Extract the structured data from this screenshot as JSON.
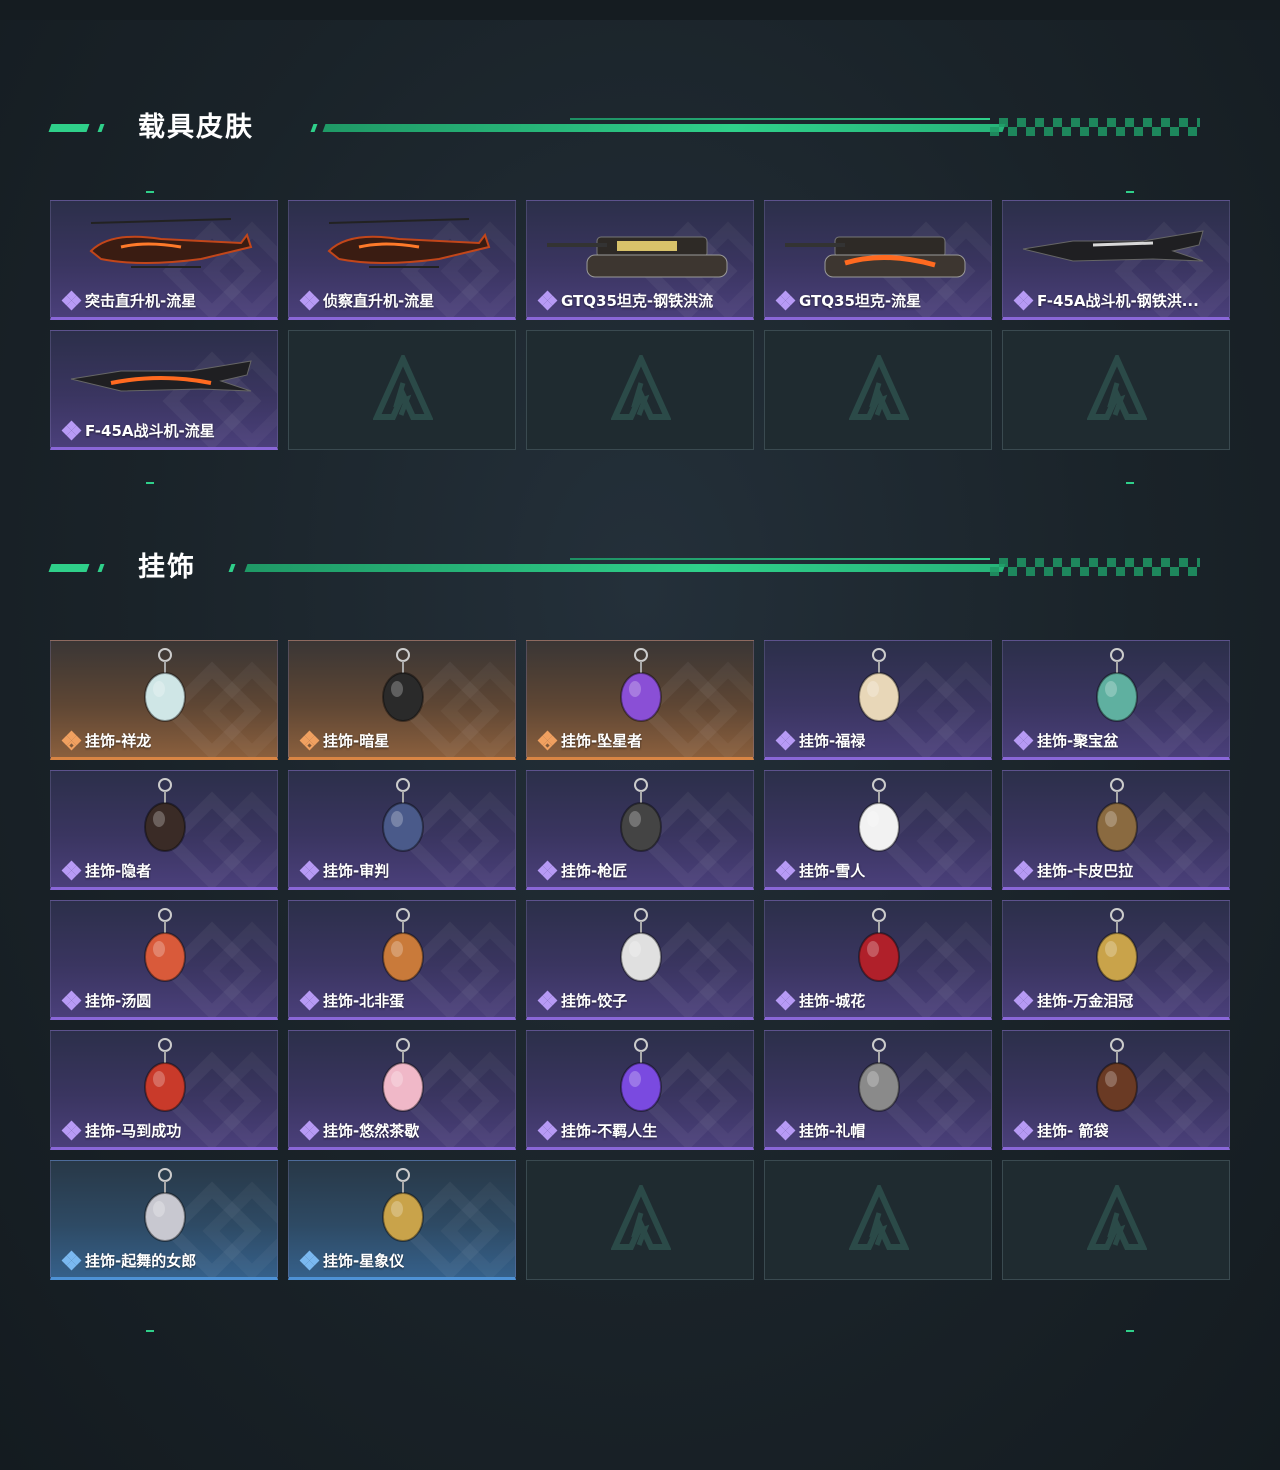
{
  "sections": [
    {
      "title": "载具皮肤",
      "items": [
        {
          "name": "突击直升机-流星",
          "rarity": "epic",
          "icon": "helicopter-attack-icon"
        },
        {
          "name": "侦察直升机-流星",
          "rarity": "epic",
          "icon": "helicopter-scout-icon"
        },
        {
          "name": "GTQ35坦克-钢铁洪流",
          "rarity": "epic",
          "icon": "tank-steel-icon"
        },
        {
          "name": "GTQ35坦克-流星",
          "rarity": "epic",
          "icon": "tank-meteor-icon"
        },
        {
          "name": "F-45A战斗机-钢铁洪...",
          "rarity": "epic",
          "icon": "jet-steel-icon"
        },
        {
          "name": "F-45A战斗机-流星",
          "rarity": "epic",
          "icon": "jet-meteor-icon"
        },
        {
          "name": "",
          "rarity": "empty"
        },
        {
          "name": "",
          "rarity": "empty"
        },
        {
          "name": "",
          "rarity": "empty"
        },
        {
          "name": "",
          "rarity": "empty"
        }
      ]
    },
    {
      "title": "挂饰",
      "items": [
        {
          "name": "挂饰-祥龙",
          "rarity": "legend",
          "icon": "dragon-charm-icon"
        },
        {
          "name": "挂饰-暗星",
          "rarity": "legend",
          "icon": "dark-star-charm-icon"
        },
        {
          "name": "挂饰-坠星者",
          "rarity": "legend",
          "icon": "crystal-charm-icon"
        },
        {
          "name": "挂饰-福禄",
          "rarity": "epic",
          "icon": "gourd-charm-icon"
        },
        {
          "name": "挂饰-聚宝盆",
          "rarity": "epic",
          "icon": "treasure-bowl-charm-icon"
        },
        {
          "name": "挂饰-隐者",
          "rarity": "epic",
          "icon": "hermit-card-charm-icon"
        },
        {
          "name": "挂饰-审判",
          "rarity": "epic",
          "icon": "judgement-card-charm-icon"
        },
        {
          "name": "挂饰-枪匠",
          "rarity": "epic",
          "icon": "gunsmith-charm-icon"
        },
        {
          "name": "挂饰-雪人",
          "rarity": "epic",
          "icon": "snowman-charm-icon"
        },
        {
          "name": "挂饰-卡皮巴拉",
          "rarity": "epic",
          "icon": "capybara-charm-icon"
        },
        {
          "name": "挂饰-汤圆",
          "rarity": "epic",
          "icon": "tangyuan-charm-icon"
        },
        {
          "name": "挂饰-北非蛋",
          "rarity": "epic",
          "icon": "shakshuka-charm-icon"
        },
        {
          "name": "挂饰-饺子",
          "rarity": "epic",
          "icon": "dumpling-charm-icon"
        },
        {
          "name": "挂饰-城花",
          "rarity": "epic",
          "icon": "rose-charm-icon"
        },
        {
          "name": "挂饰-万金泪冠",
          "rarity": "epic",
          "icon": "crown-charm-icon"
        },
        {
          "name": "挂饰-马到成功",
          "rarity": "epic",
          "icon": "horse-charm-icon"
        },
        {
          "name": "挂饰-悠然茶歇",
          "rarity": "epic",
          "icon": "cupcake-charm-icon"
        },
        {
          "name": "挂饰-不羁人生",
          "rarity": "epic",
          "icon": "sneaker-charm-icon"
        },
        {
          "name": "挂饰-礼帽",
          "rarity": "epic",
          "icon": "hat-charm-icon"
        },
        {
          "name": "挂饰- 箭袋",
          "rarity": "epic",
          "icon": "quiver-charm-icon"
        },
        {
          "name": "挂饰-起舞的女郎",
          "rarity": "rare",
          "icon": "dancer-charm-icon"
        },
        {
          "name": "挂饰-星象仪",
          "rarity": "rare",
          "icon": "orrery-charm-icon"
        },
        {
          "name": "",
          "rarity": "empty"
        },
        {
          "name": "",
          "rarity": "empty"
        },
        {
          "name": "",
          "rarity": "empty"
        }
      ]
    }
  ],
  "colors": {
    "accent": "#2fd08a",
    "epic": "#8a67d8",
    "legend": "#d98544",
    "rare": "#4e92d6"
  }
}
